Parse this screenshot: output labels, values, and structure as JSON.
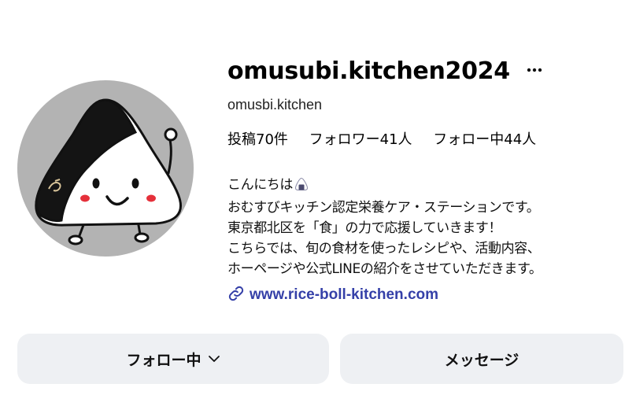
{
  "profile": {
    "username": "omusubi.kitchen2024",
    "display_name": "omusbi.kitchen",
    "more_icon": "more-horizontal-icon"
  },
  "stats": {
    "posts": "投稿70件",
    "followers": "フォロワー41人",
    "following": "フォロー中44人"
  },
  "bio": {
    "lines": [
      "こんにちは",
      "おむすびキッチン認定栄養ケア・ステーションです。",
      "東京都北区を「食」の力で応援していきます！",
      "こちらでは、旬の食材を使ったレシピや、活動内容、",
      "ホーページや公式LINEの紹介をさせていただきます。"
    ],
    "emoji": "onigiri-emoji-icon"
  },
  "link": {
    "text": "www.rice-boll-kitchen.com",
    "icon": "link-icon",
    "color": "#3540a8"
  },
  "actions": {
    "follow_label": "フォロー中",
    "follow_icon": "chevron-down-icon",
    "message_label": "メッセージ"
  },
  "colors": {
    "button_bg": "#eef0f3",
    "avatar_bg": "#b3b3b3"
  }
}
